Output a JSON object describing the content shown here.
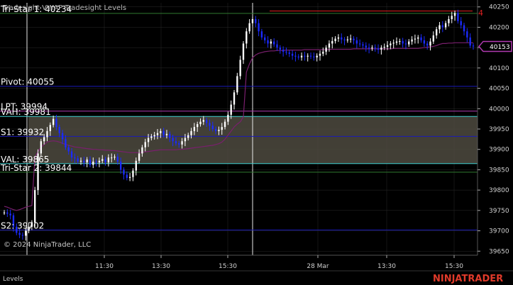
{
  "window": {
    "indicator_title": "Tradesight VWAP Tradesight Levels",
    "copyright": "© 2024 NinjaTrader, LLC",
    "panel_label": "Levels",
    "brand_ninja": "NINJA",
    "brand_trader": "TRADER",
    "flag_label": "4"
  },
  "colors": {
    "background": "#000000",
    "up_candle": "#ffffff",
    "down_candle": "#1b2bff",
    "vwap": "#7a1f6e",
    "value_area": "#4d4a40",
    "level_blue": "#1a1ab8",
    "level_cyan": "#3fd0d0",
    "level_green": "#2f7a2f",
    "level_magenta": "#b03ab0",
    "grid": "#2a2a2a",
    "brand_red": "#e03a2a",
    "flag_red": "#e02020"
  },
  "chart_data": {
    "type": "candlestick",
    "y_axis": {
      "min": 39640,
      "max": 40260,
      "ticks": [
        40250,
        40200,
        40150,
        40100,
        40050,
        40000,
        39950,
        39900,
        39850,
        39800,
        39750,
        39700,
        39650
      ]
    },
    "x_axis": {
      "tick_labels": [
        "11:30",
        "13:30",
        "15:30",
        "28 Mar",
        "13:30",
        "15:30"
      ]
    },
    "last_price": 40153,
    "levels": [
      {
        "name": "Tri-Star 1",
        "label": "Tri-Star 1: 40234",
        "value": 40234,
        "color": "#2f7a2f"
      },
      {
        "name": "Pivot",
        "label": "Pivot: 40055",
        "value": 40055,
        "color": "#1a1ab8"
      },
      {
        "name": "LPT",
        "label": "LPT: 39994",
        "value": 39994,
        "color": "#b03ab0"
      },
      {
        "name": "VAH",
        "label": "VAH: 39981",
        "value": 39981,
        "color": "#3fd0d0"
      },
      {
        "name": "S1",
        "label": "S1: 39932",
        "value": 39932,
        "color": "#1a1ab8"
      },
      {
        "name": "VAL",
        "label": "VAL: 39865",
        "value": 39865,
        "color": "#3fd0d0"
      },
      {
        "name": "Tri-Star 2",
        "label": "Tri-Star 2: 39844",
        "value": 39844,
        "color": "#2f7a2f"
      },
      {
        "name": "S2",
        "label": "S2: 39702",
        "value": 39702,
        "color": "#1a1ab8"
      }
    ],
    "closes": [
      39745,
      39742,
      39738,
      39710,
      39695,
      39690,
      39688,
      39700,
      39710,
      39720,
      39800,
      39890,
      39920,
      39930,
      39945,
      39960,
      39975,
      39955,
      39940,
      39925,
      39905,
      39895,
      39880,
      39878,
      39870,
      39872,
      39868,
      39875,
      39862,
      39870,
      39868,
      39872,
      39876,
      39868,
      39880,
      39880,
      39882,
      39870,
      39850,
      39838,
      39830,
      39832,
      39848,
      39872,
      39890,
      39905,
      39918,
      39928,
      39932,
      39935,
      39940,
      39945,
      39935,
      39938,
      39928,
      39920,
      39915,
      39912,
      39920,
      39928,
      39935,
      39945,
      39955,
      39962,
      39968,
      39972,
      39965,
      39958,
      39950,
      39945,
      39948,
      39955,
      39968,
      39985,
      40010,
      40040,
      40080,
      40120,
      40160,
      40190,
      40210,
      40220,
      40210,
      40190,
      40175,
      40168,
      40160,
      40165,
      40158,
      40150,
      40145,
      40140,
      40138,
      40135,
      40130,
      40128,
      40126,
      40130,
      40128,
      40130,
      40128,
      40126,
      40130,
      40135,
      40140,
      40150,
      40160,
      40166,
      40172,
      40175,
      40170,
      40168,
      40170,
      40172,
      40168,
      40160,
      40158,
      40155,
      40150,
      40148,
      40150,
      40148,
      40145,
      40150,
      40152,
      40156,
      40160,
      40162,
      40165,
      40166,
      40160,
      40158,
      40165,
      40170,
      40172,
      40175,
      40168,
      40160,
      40155,
      40165,
      40180,
      40195,
      40205,
      40200,
      40210,
      40220,
      40228,
      40235,
      40215,
      40205,
      40190,
      40175,
      40155,
      40153
    ],
    "vwap": [
      39760,
      39758,
      39755,
      39752,
      39750,
      39752,
      39755,
      39758,
      39760,
      39762,
      39880,
      39895,
      39905,
      39912,
      39918,
      39920,
      39921,
      39920,
      39918,
      39915,
      39912,
      39910,
      39908,
      39906,
      39905,
      39904,
      39903,
      39902,
      39901,
      39900,
      39900,
      39899,
      39899,
      39898,
      39898,
      39897,
      39897,
      39896,
      39895,
      39894,
      39893,
      39892,
      39892,
      39892,
      39892,
      39893,
      39894,
      39895,
      39896,
      39897,
      39898,
      39899,
      39899,
      39899,
      39899,
      39899,
      39899,
      39900,
      39900,
      39901,
      39902,
      39903,
      39904,
      39905,
      39906,
      39907,
      39908,
      39909,
      39910,
      39912,
      39914,
      39918,
      39925,
      39935,
      39945,
      39955,
      39962,
      39968,
      39980,
      40090,
      40110,
      40125,
      40132,
      40136,
      40138,
      40140,
      40141,
      40142,
      40142,
      40143,
      40143,
      40143,
      40144,
      40144,
      40144,
      40144,
      40144,
      40144,
      40145,
      40145,
      40145,
      40145,
      40145,
      40145,
      40145,
      40145,
      40146,
      40146,
      40146,
      40146,
      40146,
      40146,
      40146,
      40146,
      40147,
      40147,
      40147,
      40147,
      40147,
      40147,
      40147,
      40147,
      40147,
      40147,
      40147,
      40147,
      40147,
      40148,
      40148,
      40148,
      40148,
      40148,
      40148,
      40148,
      40148,
      40148,
      40149,
      40150,
      40151,
      40152,
      40153,
      40155,
      40158,
      40160,
      40160,
      40161,
      40161,
      40162,
      40162,
      40162,
      40162,
      40162,
      40162,
      40162
    ]
  }
}
